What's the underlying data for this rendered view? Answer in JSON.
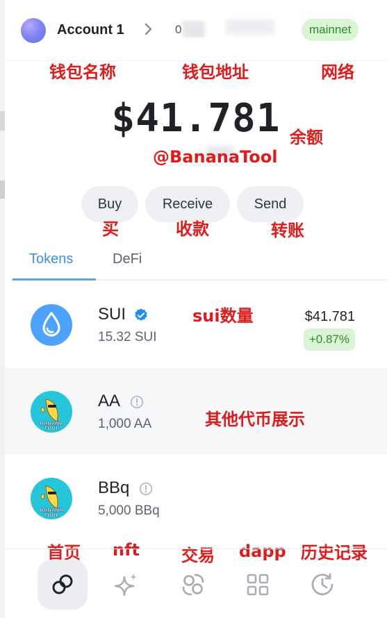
{
  "header": {
    "account_name": "Account 1",
    "address_prefix": "0",
    "network": "mainnet"
  },
  "annotations": {
    "wallet_name": "钱包名称",
    "wallet_address": "钱包地址",
    "network": "网络",
    "balance": "余额",
    "handle": "@BananaTool",
    "buy": "买",
    "receive": "收款",
    "send": "转账",
    "sui_qty": "sui数量",
    "other_tokens": "其他代币展示",
    "home": "首页",
    "nft": "nft",
    "swap": "交易",
    "dapp": "dapp",
    "history": "历史记录"
  },
  "balance": "$41.781",
  "actions": {
    "buy": "Buy",
    "receive": "Receive",
    "send": "Send"
  },
  "tabs": {
    "tokens": "Tokens",
    "defi": "DeFi"
  },
  "tokens": [
    {
      "symbol": "SUI",
      "amount": "15.32 SUI",
      "usd": "$41.781",
      "change": "+0.87%",
      "verified": true
    },
    {
      "symbol": "AA",
      "amount": "1,000 AA",
      "verified": false
    },
    {
      "symbol": "BBq",
      "amount": "5,000 BBq",
      "verified": false
    }
  ],
  "icons": {
    "sui": "droplet-icon",
    "verified": "verified-badge-icon",
    "info": "info-circle-icon",
    "nav": [
      "home-icon",
      "sparkle-nft-icon",
      "swap-icon",
      "apps-grid-icon",
      "history-clock-icon"
    ]
  },
  "colors": {
    "annotation": "#e01b1b",
    "accent_blue": "#3f8fe0",
    "sui_blue": "#4da2ff",
    "positive_bg": "#d9f5d5",
    "positive_fg": "#2f8a2a",
    "banana_bg": "#26c6da"
  }
}
